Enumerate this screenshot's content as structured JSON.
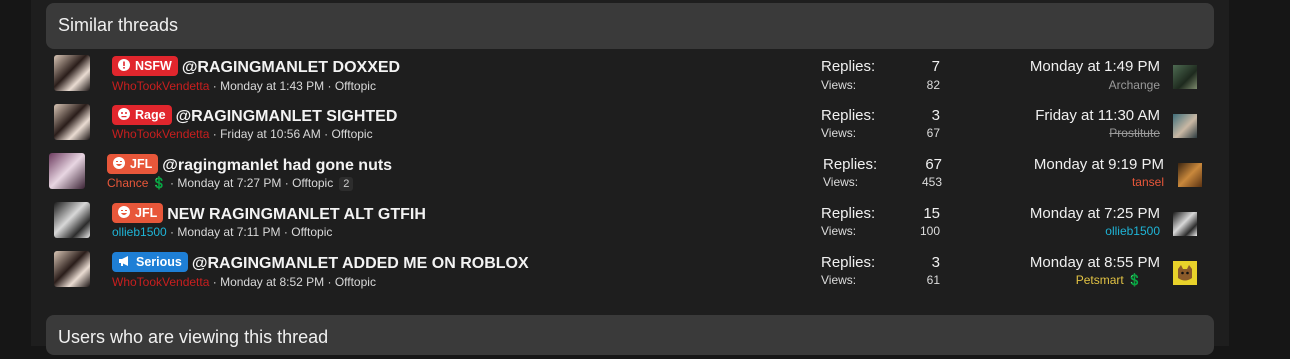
{
  "similar": {
    "heading": "Similar threads"
  },
  "viewing": {
    "heading": "Users who are viewing this thread"
  },
  "threads": [
    {
      "label": "NSFW",
      "label_color": "#e1262d",
      "label_icon": "exclamation-icon",
      "title": "@RAGINGMANLET DOXXED",
      "author": "WhoTookVendetta",
      "date": "Monday at 1:43 PM",
      "forum": "Offtopic",
      "replies_label": "Replies:",
      "replies": "7",
      "views_label": "Views:",
      "views": "82",
      "last_date": "Monday at 1:49 PM",
      "last_user": "Archange"
    },
    {
      "label": "Rage",
      "label_color": "#e1262d",
      "label_icon": "angry-face-icon",
      "title": "@RAGINGMANLET SIGHTED",
      "author": "WhoTookVendetta",
      "date": "Friday at 10:56 AM",
      "forum": "Offtopic",
      "replies_label": "Replies:",
      "replies": "3",
      "views_label": "Views:",
      "views": "67",
      "last_date": "Friday at 11:30 AM",
      "last_user": "Prostitute"
    },
    {
      "label": "JFL",
      "label_color": "#e8573a",
      "label_icon": "laugh-icon",
      "title": "@ragingmanlet had gone nuts",
      "author": "Chance",
      "date": "Monday at 7:27 PM",
      "forum": "Offtopic",
      "pages": "2",
      "replies_label": "Replies:",
      "replies": "67",
      "views_label": "Views:",
      "views": "453",
      "last_date": "Monday at 9:19 PM",
      "last_user": "tansel"
    },
    {
      "label": "JFL",
      "label_color": "#e8573a",
      "label_icon": "laugh-icon",
      "title": "NEW RAGINGMANLET ALT GTFIH",
      "author": "ollieb1500",
      "date": "Monday at 7:11 PM",
      "forum": "Offtopic",
      "replies_label": "Replies:",
      "replies": "15",
      "views_label": "Views:",
      "views": "100",
      "last_date": "Monday at 7:25 PM",
      "last_user": "ollieb1500"
    },
    {
      "label": "Serious",
      "label_color": "#1e7fd6",
      "label_icon": "megaphone-icon",
      "title": "@RAGINGMANLET ADDED ME ON ROBLOX",
      "author": "WhoTookVendetta",
      "date": "Monday at 8:52 PM",
      "forum": "Offtopic",
      "replies_label": "Replies:",
      "replies": "3",
      "views_label": "Views:",
      "views": "61",
      "last_date": "Monday at 8:55 PM",
      "last_user": "Petsmart"
    }
  ]
}
